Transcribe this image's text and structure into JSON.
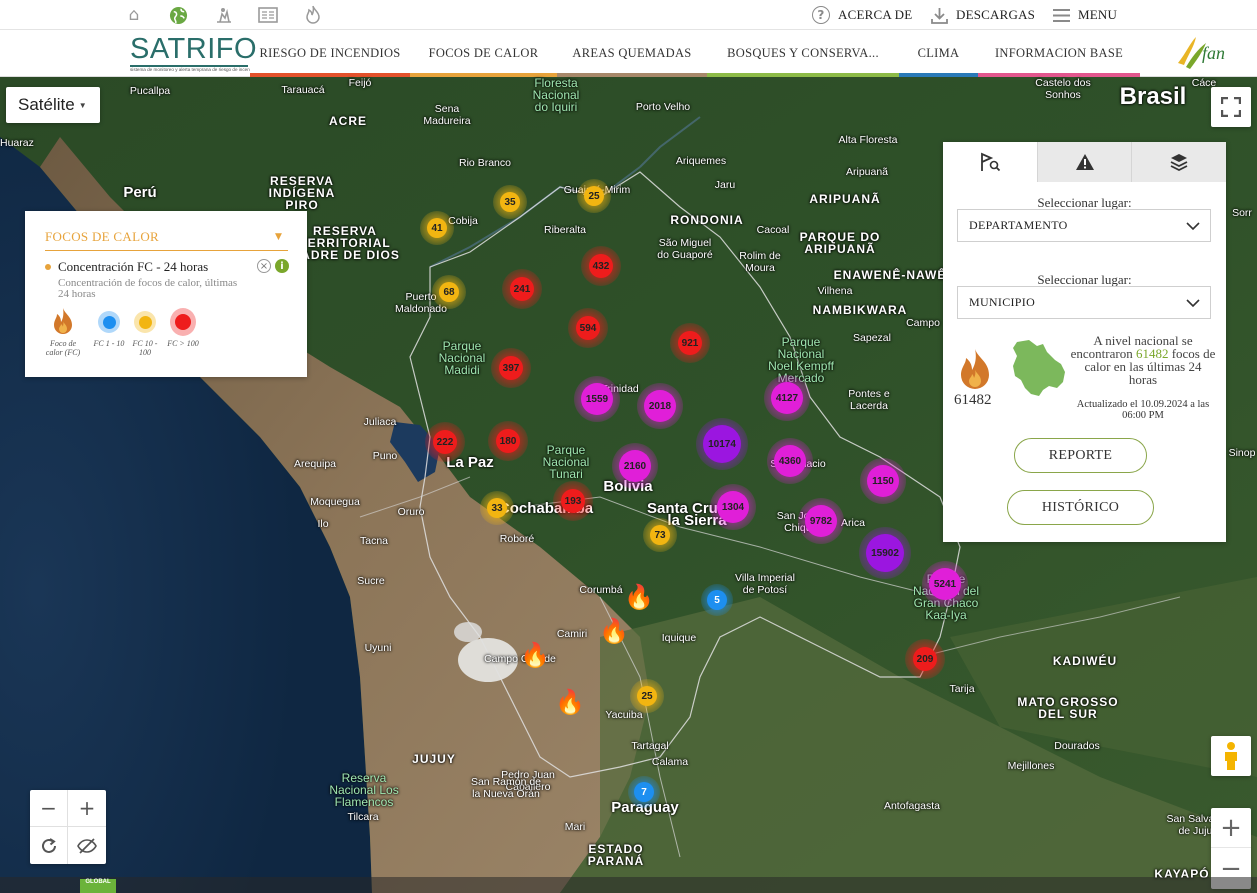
{
  "topbar": {
    "icons": [
      "home-icon",
      "globe-icon",
      "fire-monitor-icon",
      "document-icon",
      "flame-icon"
    ],
    "about_label": "ACERCA DE",
    "downloads_label": "DESCARGAS",
    "menu_label": "MENU"
  },
  "logo": {
    "word": "SATRIFO",
    "tagline": "sistema de monitoreo y alerta temprana de riesgo de incendios forestales"
  },
  "nav": {
    "items": [
      {
        "label": "RIESGO DE INCENDIOS",
        "color": "#e3512b"
      },
      {
        "label": "FOCOS DE CALOR",
        "color": "#e7a33b"
      },
      {
        "label": "AREAS QUEMADAS",
        "color": "#a7886a"
      },
      {
        "label": "BOSQUES Y CONSERVA...",
        "color": "#8dbb47"
      },
      {
        "label": "CLIMA",
        "color": "#2a7ab8"
      },
      {
        "label": "INFORMACION BASE",
        "color": "#e2568d"
      }
    ]
  },
  "map": {
    "basemap_label": "Satélite",
    "labels": [
      {
        "text": "Pucallpa",
        "cls": ""
      },
      {
        "text": "Feijó",
        "cls": ""
      },
      {
        "text": "Tarauacá",
        "cls": ""
      },
      {
        "text": "Floresta\nNacional\ndo Iquiri",
        "cls": "park"
      },
      {
        "text": "Porto Velho",
        "cls": ""
      },
      {
        "text": "Castelo dos\nSonhos",
        "cls": ""
      },
      {
        "text": "Brasil",
        "cls": "big"
      },
      {
        "text": "ACRE",
        "cls": "region"
      },
      {
        "text": "Sena\nMadureira",
        "cls": ""
      },
      {
        "text": "Huaraz",
        "cls": ""
      },
      {
        "text": "Perú",
        "cls": "country"
      },
      {
        "text": "RESERVA\nINDÍGENA\nPIRO",
        "cls": "region"
      },
      {
        "text": "Rio Branco",
        "cls": ""
      },
      {
        "text": "Ariquemes",
        "cls": ""
      },
      {
        "text": "Jaru",
        "cls": ""
      },
      {
        "text": "Alta Floresta",
        "cls": ""
      },
      {
        "text": "Aripuanã",
        "cls": ""
      },
      {
        "text": "ARIPUANÃ",
        "cls": "region"
      },
      {
        "text": "Guajará-Mirim",
        "cls": ""
      },
      {
        "text": "RONDONIA",
        "cls": "region"
      },
      {
        "text": "Cobija",
        "cls": ""
      },
      {
        "text": "Riberalta",
        "cls": ""
      },
      {
        "text": "Cacoal",
        "cls": ""
      },
      {
        "text": "PARQUE DO\nARIPUANÃ",
        "cls": "region"
      },
      {
        "text": "São Miguel\ndo Guaporé",
        "cls": ""
      },
      {
        "text": "Rolim de\nMoura",
        "cls": ""
      },
      {
        "text": "ENAWENÊ-NAWÊ",
        "cls": "region"
      },
      {
        "text": "RESERVA\nTERRITORIAL\nMADRE DE DIOS",
        "cls": "region"
      },
      {
        "text": "Vilhena",
        "cls": ""
      },
      {
        "text": "NAMBIKWARA",
        "cls": "region"
      },
      {
        "text": "Puerto\nMaldonado",
        "cls": ""
      },
      {
        "text": "Sapezal",
        "cls": ""
      },
      {
        "text": "Campo",
        "cls": ""
      },
      {
        "text": "Parque\nNacional\nMadidi",
        "cls": "park"
      },
      {
        "text": "Parque\nNacional\nNoel Kempff\nMercado",
        "cls": "park"
      },
      {
        "text": "Trinidad",
        "cls": ""
      },
      {
        "text": "Pontes e\nLacerda",
        "cls": ""
      },
      {
        "text": "Juliaca",
        "cls": ""
      },
      {
        "text": "Puno",
        "cls": ""
      },
      {
        "text": "Arequipa",
        "cls": ""
      },
      {
        "text": "La Paz",
        "cls": "country"
      },
      {
        "text": "Parque\nNacional\nTunari",
        "cls": "park"
      },
      {
        "text": "Bolivia",
        "cls": "country"
      },
      {
        "text": "San Ignacio",
        "cls": ""
      },
      {
        "text": "Cochabamba",
        "cls": "country"
      },
      {
        "text": "Santa Cruz de\nla Sierra",
        "cls": "country"
      },
      {
        "text": "San José de\nChiquitos",
        "cls": ""
      },
      {
        "text": "Moquegua",
        "cls": ""
      },
      {
        "text": "Ilo",
        "cls": ""
      },
      {
        "text": "Tacna",
        "cls": ""
      },
      {
        "text": "Oruro",
        "cls": ""
      },
      {
        "text": "Roboré",
        "cls": ""
      },
      {
        "text": "Arica",
        "cls": ""
      },
      {
        "text": "Sucre",
        "cls": ""
      },
      {
        "text": "Corumbá",
        "cls": ""
      },
      {
        "text": "Parque\nNacional del\nGran Chaco\nKaa-Iya",
        "cls": "park"
      },
      {
        "text": "Villa Imperial\nde Potosí",
        "cls": ""
      },
      {
        "text": "Camiri",
        "cls": ""
      },
      {
        "text": "Iquique",
        "cls": ""
      },
      {
        "text": "Uyuni",
        "cls": ""
      },
      {
        "text": "Campo Grande",
        "cls": ""
      },
      {
        "text": "KADIWÉU",
        "cls": "region"
      },
      {
        "text": "Tarija",
        "cls": ""
      },
      {
        "text": "MATO GROSSO\nDEL SUR",
        "cls": "region"
      },
      {
        "text": "Dourados",
        "cls": ""
      },
      {
        "text": "Yacuiba",
        "cls": ""
      },
      {
        "text": "Tartagal",
        "cls": ""
      },
      {
        "text": "Calama",
        "cls": ""
      },
      {
        "text": "JUJUY",
        "cls": "region"
      },
      {
        "text": "Pedro Juan\nCaballero",
        "cls": ""
      },
      {
        "text": "Mejillones",
        "cls": ""
      },
      {
        "text": "Reserva\nNacional Los\nFlamencos",
        "cls": "park"
      },
      {
        "text": "San Ramón de\nla Nueva Orán",
        "cls": ""
      },
      {
        "text": "Paraguay",
        "cls": "country"
      },
      {
        "text": "Antofagasta",
        "cls": ""
      },
      {
        "text": "Tilcara",
        "cls": ""
      },
      {
        "text": "Mari",
        "cls": ""
      },
      {
        "text": "San Salvador\nde Jujuy",
        "cls": ""
      },
      {
        "text": "ESTADO\nPARANÁ",
        "cls": "region"
      },
      {
        "text": "KAYAPÓ",
        "cls": "region"
      },
      {
        "text": "Cáce",
        "cls": ""
      },
      {
        "text": "Sinop",
        "cls": ""
      },
      {
        "text": "Sorr",
        "cls": ""
      }
    ],
    "clusters": [
      {
        "count": "35",
        "level": "yellow"
      },
      {
        "count": "25",
        "level": "yellow"
      },
      {
        "count": "41",
        "level": "yellow"
      },
      {
        "count": "432",
        "level": "red"
      },
      {
        "count": "241",
        "level": "red"
      },
      {
        "count": "68",
        "level": "yellow"
      },
      {
        "count": "594",
        "level": "red"
      },
      {
        "count": "921",
        "level": "red"
      },
      {
        "count": "397",
        "level": "red"
      },
      {
        "count": "1559",
        "level": "magenta"
      },
      {
        "count": "2018",
        "level": "magenta"
      },
      {
        "count": "4127",
        "level": "magenta"
      },
      {
        "count": "222",
        "level": "red"
      },
      {
        "count": "180",
        "level": "red"
      },
      {
        "count": "10174",
        "level": "purple"
      },
      {
        "count": "4360",
        "level": "magenta"
      },
      {
        "count": "2160",
        "level": "magenta"
      },
      {
        "count": "1150",
        "level": "magenta"
      },
      {
        "count": "33",
        "level": "yellow"
      },
      {
        "count": "193",
        "level": "red"
      },
      {
        "count": "1304",
        "level": "magenta"
      },
      {
        "count": "9782",
        "level": "magenta"
      },
      {
        "count": "73",
        "level": "yellow"
      },
      {
        "count": "15902",
        "level": "purple"
      },
      {
        "count": "5241",
        "level": "magenta"
      },
      {
        "count": "5",
        "level": "blue"
      },
      {
        "count": "209",
        "level": "red"
      },
      {
        "count": "25",
        "level": "yellow"
      },
      {
        "count": "7",
        "level": "blue"
      }
    ],
    "level_colors": {
      "yellow": "#f2b511",
      "red": "#ee1c1c",
      "magenta": "#e01fd8",
      "purple": "#9b16e0",
      "blue": "#1d8ff0"
    }
  },
  "legend": {
    "title": "FOCOS DE CALOR",
    "layer_name": "Concentración FC - 24 horas",
    "layer_desc": "Concentración de focos de calor, últimas 24 horas",
    "items": [
      {
        "label": "Foco de calor (FC)",
        "kind": "fire"
      },
      {
        "label": "FC 1 - 10",
        "kind": "blue"
      },
      {
        "label": "FC 10 - 100",
        "kind": "yellow"
      },
      {
        "label": "FC > 100",
        "kind": "red"
      }
    ]
  },
  "panel": {
    "tabs": [
      "search-location-icon",
      "alert-icon",
      "layers-icon"
    ],
    "select_label_1": "Seleccionar lugar:",
    "select_value_1": "DEPARTAMENTO",
    "select_label_2": "Seleccionar lugar:",
    "select_value_2": "MUNICIPIO",
    "national_count": "61482",
    "national_text_pre": "A nivel nacional se encontraron",
    "national_text_highlight": "61482",
    "national_text_post": "focos de calor en las últimas 24 horas",
    "updated": "Actualizado el 10.09.2024 a las 06:00 PM",
    "report_button": "REPORTE",
    "history_button": "HISTÓRICO"
  },
  "controls": {
    "zoom_in": "+",
    "zoom_out": "−"
  }
}
